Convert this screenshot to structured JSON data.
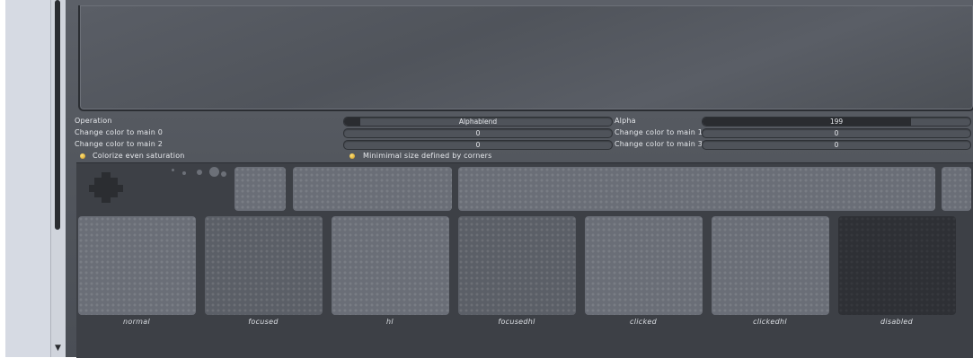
{
  "controls": {
    "operation_label": "Operation",
    "operation_value": "Alphablend",
    "alpha_label": "Alpha",
    "alpha_value": "199",
    "alpha_fraction": 0.78,
    "main0_label": "Change color to main 0",
    "main0_value": "0",
    "main1_label": "Change color to main 1",
    "main1_value": "0",
    "main2_label": "Change color to main 2",
    "main2_value": "0",
    "main3_label": "Change color to main 3",
    "main3_value": "0",
    "colorize_label": "Colorize even saturation",
    "minimal_label": "Minimimal size defined by corners"
  },
  "states": [
    "normal",
    "focused",
    "hl",
    "focusedhl",
    "clicked",
    "clickedhl",
    "disabled"
  ],
  "colors": {
    "panel": "#53575e",
    "tile": "#6a6e77",
    "checkbox": "#e0b030"
  }
}
